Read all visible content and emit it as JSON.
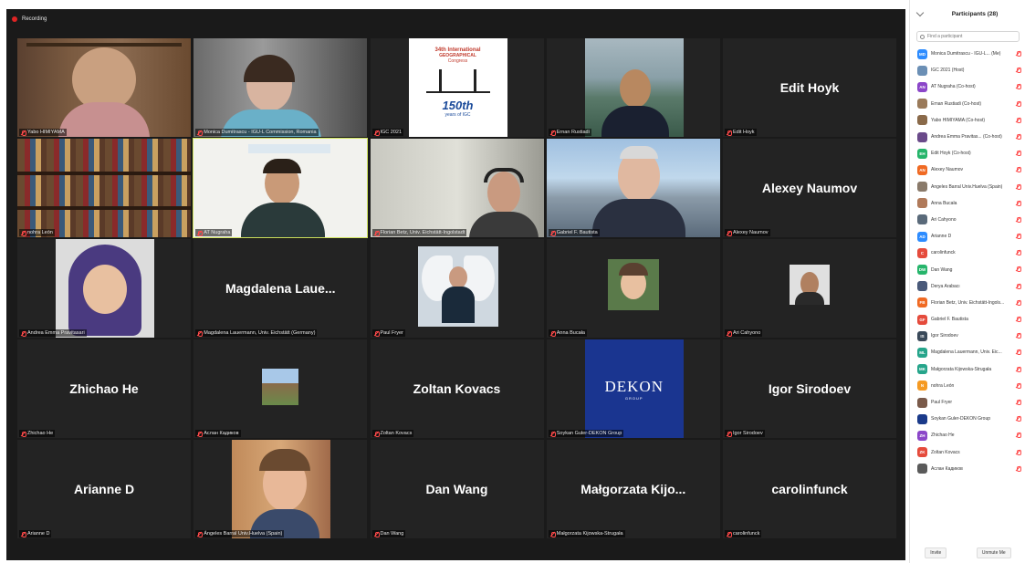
{
  "meeting": {
    "recording_label": "Recording"
  },
  "tiles": [
    {
      "name": "Yabo HIMIYAMA",
      "big": "",
      "kind": "bookshelf-man"
    },
    {
      "name": "Monica Dumitrascu - IGU-L Commission, Romania",
      "big": "",
      "kind": "woman-room"
    },
    {
      "name": "IGC 2021",
      "big": "",
      "kind": "logo"
    },
    {
      "name": "Ernan Rustiadi",
      "big": "",
      "kind": "man-lake"
    },
    {
      "name": "Edit Hoyk",
      "big": "Edit Hoyk",
      "kind": "name"
    },
    {
      "name": "nohra León",
      "big": "",
      "kind": "bookshelf"
    },
    {
      "name": "AT Nugraha",
      "big": "",
      "kind": "man-banner",
      "active": true
    },
    {
      "name": "Florian Betz, Univ. Eichstätt-Ingolstadt",
      "big": "",
      "kind": "man-headset"
    },
    {
      "name": "Gabriel F. Bautista",
      "big": "",
      "kind": "man-city"
    },
    {
      "name": "Alexey Naumov",
      "big": "Alexey Naumov",
      "kind": "name"
    },
    {
      "name": "Andrea Emma Pravitasari",
      "big": "",
      "kind": "woman-hijab"
    },
    {
      "name": "Magdalena Lauermann, Univ. Eichstätt (Germany)",
      "big": "Magdalena Laue...",
      "kind": "name"
    },
    {
      "name": "Paul Fryer",
      "big": "",
      "kind": "wings"
    },
    {
      "name": "Anna Bucała",
      "big": "",
      "kind": "small-face"
    },
    {
      "name": "Ari Cahyono",
      "big": "",
      "kind": "small-face2"
    },
    {
      "name": "Zhichao He",
      "big": "Zhichao He",
      "kind": "name"
    },
    {
      "name": "Аслан Кадиков",
      "big": "",
      "kind": "landscape"
    },
    {
      "name": "Zoltan Kovacs",
      "big": "Zoltan Kovacs",
      "kind": "name"
    },
    {
      "name": "Soykan Guler-DEKON Group",
      "big": "",
      "kind": "dekon"
    },
    {
      "name": "Igor Sirodoev",
      "big": "Igor Sirodoev",
      "kind": "name"
    },
    {
      "name": "Arianne D",
      "big": "Arianne D",
      "kind": "name"
    },
    {
      "name": "Ángeles Barral Univ.Huelva (Spain)",
      "big": "",
      "kind": "woman-smile"
    },
    {
      "name": "Dan Wang",
      "big": "Dan Wang",
      "kind": "name"
    },
    {
      "name": "Małgorzata Kijowska-Strugała",
      "big": "Małgorzata Kijo...",
      "kind": "name"
    },
    {
      "name": "carolinfunck",
      "big": "carolinfunck",
      "kind": "name"
    }
  ],
  "logo": {
    "line1": "34th International",
    "line2": "GEOGRAPHICAL",
    "line3": "Congress",
    "badge": "150th",
    "badge2": "years of IGC"
  },
  "dekon": {
    "text": "DEKON",
    "sub": "GROUP"
  },
  "panel": {
    "title": "Participants (28)",
    "search_placeholder": "Find a participant",
    "invite_label": "Invite",
    "unmute_label": "Unmute Me",
    "participants": [
      {
        "initials": "MD",
        "color": "#2d8cff",
        "name": "Monica Dumitrascu - IGU-L... (Me)"
      },
      {
        "initials": "",
        "color": "#6b8fb5",
        "name": "IGC 2021 (Host)"
      },
      {
        "initials": "AN",
        "color": "#8b46c9",
        "name": "AT Nugraha (Co-host)"
      },
      {
        "initials": "",
        "color": "#9a7a5a",
        "name": "Ernan Rustiadi (Co-host)"
      },
      {
        "initials": "",
        "color": "#8a6a4a",
        "name": "Yabo HIMIYAMA (Co-host)"
      },
      {
        "initials": "",
        "color": "#6a4a8a",
        "name": "Andrea Emma Pravitas... (Co-host)"
      },
      {
        "initials": "EH",
        "color": "#26b56b",
        "name": "Edit Hoyk (Co-host)"
      },
      {
        "initials": "AN",
        "color": "#f06a23",
        "name": "Alexey Naumov"
      },
      {
        "initials": "",
        "color": "#8a7a6a",
        "name": "Ángeles Barral Univ.Huelva (Spain)"
      },
      {
        "initials": "",
        "color": "#b07a5a",
        "name": "Anna Bucała"
      },
      {
        "initials": "",
        "color": "#5a6a7a",
        "name": "Ari Cahyono"
      },
      {
        "initials": "AD",
        "color": "#2d8cff",
        "name": "Arianne D"
      },
      {
        "initials": "C",
        "color": "#e54b3c",
        "name": "carolinfunck"
      },
      {
        "initials": "DW",
        "color": "#26b56b",
        "name": "Dan Wang"
      },
      {
        "initials": "",
        "color": "#4a5a7a",
        "name": "Derya Arabacı"
      },
      {
        "initials": "FB",
        "color": "#f06a23",
        "name": "Florian Betz, Univ. Eichstätt-Ingols..."
      },
      {
        "initials": "GF",
        "color": "#e54b3c",
        "name": "Gabriel F. Bautista"
      },
      {
        "initials": "IS",
        "color": "#3a4a5a",
        "name": "Igor Sirodoev"
      },
      {
        "initials": "ML",
        "color": "#26a58b",
        "name": "Magdalena Lauermann, Univ. Eic..."
      },
      {
        "initials": "MK",
        "color": "#26a58b",
        "name": "Małgorzata Kijowska-Strugała"
      },
      {
        "initials": "N",
        "color": "#f59a23",
        "name": "nohra León"
      },
      {
        "initials": "",
        "color": "#7a5a4a",
        "name": "Paul Fryer"
      },
      {
        "initials": "",
        "color": "#1a3a8a",
        "name": "Soykan Guler-DEKON Group"
      },
      {
        "initials": "ZH",
        "color": "#8b46c9",
        "name": "Zhichao He"
      },
      {
        "initials": "ZK",
        "color": "#e54b3c",
        "name": "Zoltan Kovacs"
      },
      {
        "initials": "",
        "color": "#5a5a5a",
        "name": "Аслан Кадиков"
      }
    ]
  }
}
